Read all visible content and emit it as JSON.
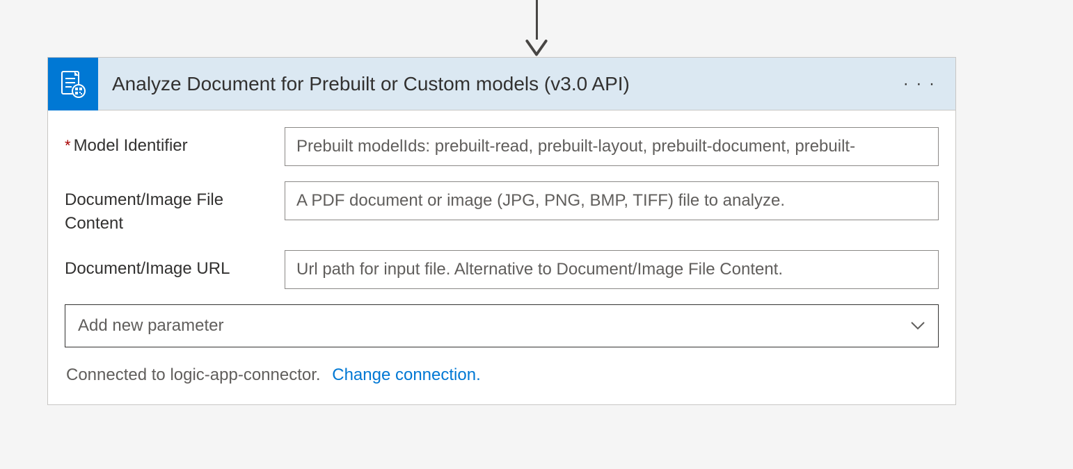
{
  "header": {
    "title": "Analyze Document for Prebuilt or Custom models (v3.0 API)"
  },
  "fields": {
    "modelIdentifier": {
      "label": "Model Identifier",
      "placeholder": "Prebuilt modelIds: prebuilt-read, prebuilt-layout, prebuilt-document, prebuilt-"
    },
    "fileContent": {
      "label": "Document/Image File Content",
      "placeholder": "A PDF document or image (JPG, PNG, BMP, TIFF) file to analyze."
    },
    "url": {
      "label": "Document/Image URL",
      "placeholder": "Url path for input file. Alternative to Document/Image File Content."
    }
  },
  "dropdown": {
    "placeholder": "Add new parameter"
  },
  "connection": {
    "statusText": "Connected to logic-app-connector.",
    "changeLink": "Change connection."
  }
}
